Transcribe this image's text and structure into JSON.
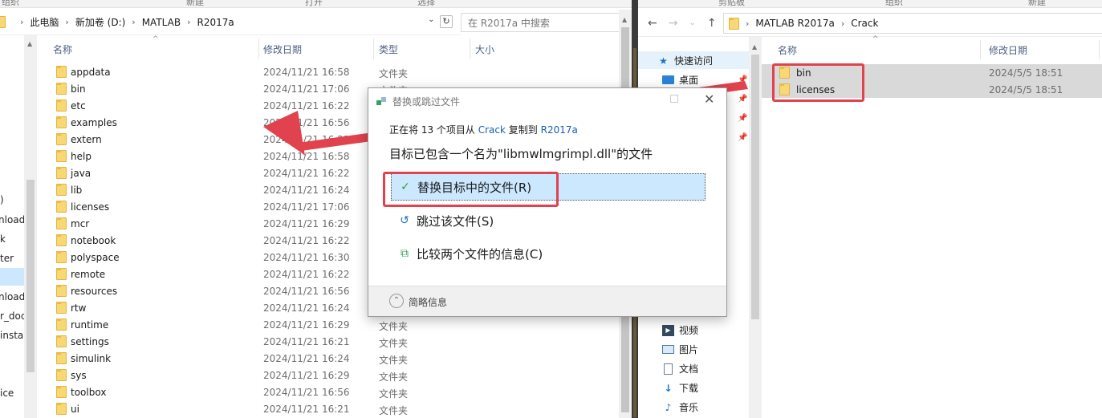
{
  "left": {
    "ribbon": [
      "组织",
      "新建",
      "打开",
      "选择"
    ],
    "breadcrumb": [
      "此电脑",
      "新加卷 (D:)",
      "MATLAB",
      "R2017a"
    ],
    "search_placeholder": "在 R2017a 中搜索",
    "headers": {
      "name": "名称",
      "date": "修改日期",
      "type": "类型",
      "size": "大小"
    },
    "nav_fragments": [
      ")",
      "nload",
      "k",
      "ter",
      "nload",
      "r_doc",
      "instal",
      "ice"
    ],
    "rows": [
      {
        "name": "appdata",
        "date": "2024/11/21 16:58",
        "type": "文件夹"
      },
      {
        "name": "bin",
        "date": "2024/11/21 17:06",
        "type": "文件夹"
      },
      {
        "name": "etc",
        "date": "2024/11/21 16:22",
        "type": ""
      },
      {
        "name": "examples",
        "date": "2024/11/21 16:56",
        "type": ""
      },
      {
        "name": "extern",
        "date": "2024/11/21 16:23",
        "type": ""
      },
      {
        "name": "help",
        "date": "2024/11/21 16:58",
        "type": ""
      },
      {
        "name": "java",
        "date": "2024/11/21 16:22",
        "type": ""
      },
      {
        "name": "lib",
        "date": "2024/11/21 16:24",
        "type": ""
      },
      {
        "name": "licenses",
        "date": "2024/11/21 17:06",
        "type": ""
      },
      {
        "name": "mcr",
        "date": "2024/11/21 16:29",
        "type": ""
      },
      {
        "name": "notebook",
        "date": "2024/11/21 16:22",
        "type": ""
      },
      {
        "name": "polyspace",
        "date": "2024/11/21 16:30",
        "type": ""
      },
      {
        "name": "remote",
        "date": "2024/11/21 16:22",
        "type": ""
      },
      {
        "name": "resources",
        "date": "2024/11/21 16:56",
        "type": ""
      },
      {
        "name": "rtw",
        "date": "2024/11/21 16:24",
        "type": ""
      },
      {
        "name": "runtime",
        "date": "2024/11/21 16:29",
        "type": "文件夹"
      },
      {
        "name": "settings",
        "date": "2024/11/21 16:21",
        "type": "文件夹"
      },
      {
        "name": "simulink",
        "date": "2024/11/21 16:24",
        "type": "文件夹"
      },
      {
        "name": "sys",
        "date": "2024/11/21 16:29",
        "type": "文件夹"
      },
      {
        "name": "toolbox",
        "date": "2024/11/21 16:56",
        "type": "文件夹"
      },
      {
        "name": "ui",
        "date": "2024/11/21 16:21",
        "type": "文件夹"
      }
    ]
  },
  "right": {
    "ribbon": [
      "剪贴板",
      "组织",
      "新建"
    ],
    "breadcrumb": [
      "MATLAB R2017a",
      "Crack"
    ],
    "headers": {
      "name": "名称",
      "date": "修改日期"
    },
    "nav": {
      "quick_access": "快速访问",
      "desktop": "桌面",
      "videos": "视频",
      "pictures": "图片",
      "documents": "文档",
      "downloads": "下载",
      "music": "音乐"
    },
    "rows": [
      {
        "name": "bin",
        "date": "2024/5/5 18:51"
      },
      {
        "name": "licenses",
        "date": "2024/5/5 18:51"
      }
    ]
  },
  "dialog": {
    "title": "替换或跳过文件",
    "progress_prefix": "正在将 13 个项目从",
    "source": "Crack",
    "copy_to": "复制到",
    "destination": "R2017a",
    "heading": "目标已包含一个名为\"libmwlmgrimpl.dll\"的文件",
    "options": {
      "replace": "替换目标中的文件(R)",
      "skip": "跳过该文件(S)",
      "compare": "比较两个文件的信息(C)"
    },
    "details_toggle": "简略信息"
  },
  "colors": {
    "annotation_red": "#e0424e",
    "selection_blue": "#cce8ff",
    "folder_yellow": "#f8d775",
    "check_green": "#2e9e3e"
  }
}
